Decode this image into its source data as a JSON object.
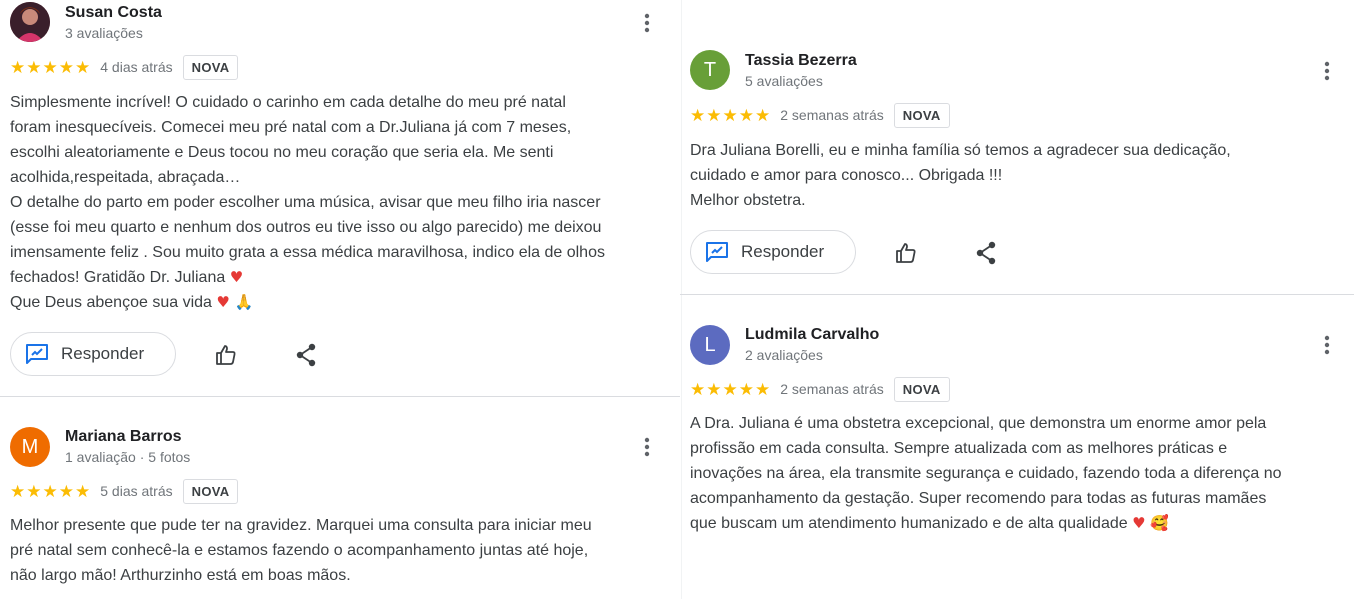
{
  "accent": {
    "star": "#fbbc04",
    "reply_icon": "#1a73e8"
  },
  "reviews": [
    {
      "name": "Susan Costa",
      "meta": "3 avaliações",
      "stars": 5,
      "date": "4 dias atrás",
      "badge": "NOVA",
      "lines": [
        "Simplesmente incrível! O cuidado o carinho em cada detalhe do meu pré natal",
        "foram inesquecíveis. Comecei meu pré natal com a Dr.Juliana já com 7 meses,",
        "escolhi aleatoriamente e Deus tocou no meu coração que seria ela. Me senti",
        "acolhida,respeitada, abraçada…",
        "O detalhe do parto em poder escolher uma música, avisar que meu filho iria nascer",
        "(esse foi meu quarto e nenhum dos outros eu tive isso ou algo parecido) me deixou",
        "imensamente feliz . Sou muito grata a essa médica maravilhosa, indico ela de olhos",
        "fechados! Gratidão Dr. Juliana",
        "Que Deus abençoe sua vida"
      ],
      "emoji_line8": "♥",
      "emoji_line9": "♥ 🙏",
      "reply_label": "Responder"
    },
    {
      "name": "Mariana Barros",
      "avatar_letter": "M",
      "meta": "1 avaliação · 5 fotos",
      "stars": 5,
      "date": "5 dias atrás",
      "badge": "NOVA",
      "lines": [
        "Melhor presente que pude ter na gravidez. Marquei uma consulta para iniciar meu",
        "pré natal sem conhecê-la e estamos fazendo o acompanhamento juntas até hoje,",
        "não largo mão! Arthurzinho está em boas mãos."
      ]
    },
    {
      "name": "Tassia Bezerra",
      "avatar_letter": "T",
      "meta": "5 avaliações",
      "stars": 5,
      "date": "2 semanas atrás",
      "badge": "NOVA",
      "lines": [
        "Dra Juliana Borelli, eu e minha família só temos a agradecer sua dedicação,",
        "cuidado e amor para conosco... Obrigada !!!",
        "Melhor obstetra."
      ],
      "reply_label": "Responder"
    },
    {
      "name": "Ludmila Carvalho",
      "avatar_letter": "L",
      "meta": "2 avaliações",
      "stars": 5,
      "date": "2 semanas atrás",
      "badge": "NOVA",
      "lines": [
        "A Dra. Juliana é uma obstetra excepcional, que demonstra um enorme amor pela",
        "profissão em cada consulta. Sempre atualizada com as melhores práticas e",
        "inovações na área, ela transmite segurança e cuidado, fazendo toda a diferença no",
        "acompanhamento da gestação. Super recomendo para todas as futuras mamães",
        "que buscam um atendimento humanizado e de alta qualidade"
      ],
      "emoji_line5": "♥ 🥰"
    }
  ]
}
